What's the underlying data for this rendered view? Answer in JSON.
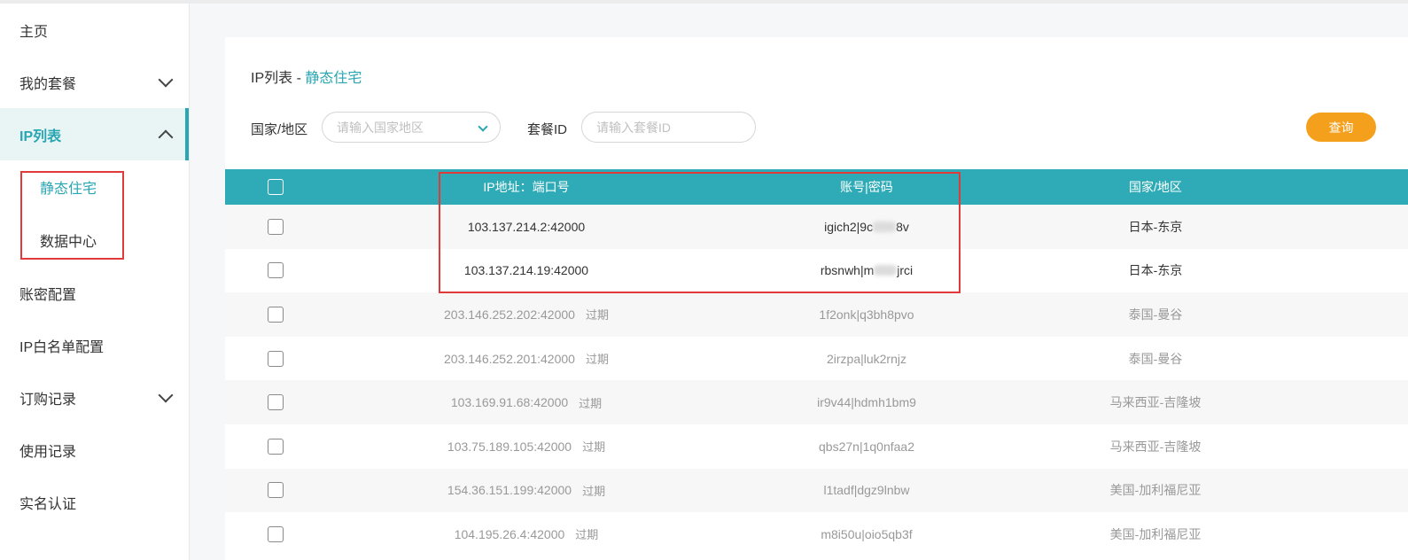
{
  "sidebar": {
    "items": [
      {
        "label": "主页"
      },
      {
        "label": "我的套餐"
      },
      {
        "label": "IP列表"
      },
      {
        "label": "账密配置"
      },
      {
        "label": "IP白名单配置"
      },
      {
        "label": "订购记录"
      },
      {
        "label": "使用记录"
      },
      {
        "label": "实名认证"
      }
    ],
    "sub_items": [
      {
        "label": "静态住宅"
      },
      {
        "label": "数据中心"
      }
    ]
  },
  "breadcrumb": {
    "parent": "IP列表",
    "sep": " - ",
    "current": "静态住宅"
  },
  "filters": {
    "country_label": "国家/地区",
    "country_placeholder": "请输入国家地区",
    "package_label": "套餐ID",
    "package_placeholder": "请输入套餐ID",
    "query_button": "查询"
  },
  "table": {
    "headers": {
      "ip": "IP地址：端口号",
      "account": "账号|密码",
      "country": "国家/地区"
    },
    "rows": [
      {
        "ip": "103.137.214.2:42000",
        "status": "",
        "acc_a": "igich2|9c",
        "acc_b": "8v",
        "country": "日本-东京"
      },
      {
        "ip": "103.137.214.19:42000",
        "status": "",
        "acc_a": "rbsnwh|m",
        "acc_b": "jrci",
        "country": "日本-东京"
      },
      {
        "ip": "203.146.252.202:42000",
        "status": "过期",
        "account": "1f2onk|q3bh8pvo",
        "country": "泰国-曼谷"
      },
      {
        "ip": "203.146.252.201:42000",
        "status": "过期",
        "account": "2irzpa|luk2rnjz",
        "country": "泰国-曼谷"
      },
      {
        "ip": "103.169.91.68:42000",
        "status": "过期",
        "account": "ir9v44|hdmh1bm9",
        "country": "马来西亚-吉隆坡"
      },
      {
        "ip": "103.75.189.105:42000",
        "status": "过期",
        "account": "qbs27n|1q0nfaa2",
        "country": "马来西亚-吉隆坡"
      },
      {
        "ip": "154.36.151.199:42000",
        "status": "过期",
        "account": "l1tadf|dgz9lnbw",
        "country": "美国-加利福尼亚"
      },
      {
        "ip": "104.195.26.4:42000",
        "status": "过期",
        "account": "m8i50u|oio5qb3f",
        "country": "美国-加利福尼亚"
      }
    ]
  },
  "colors": {
    "accent": "#2aa6b2",
    "header": "#2eabb6",
    "query": "#f4a01c",
    "annotation": "#e03a3a"
  }
}
